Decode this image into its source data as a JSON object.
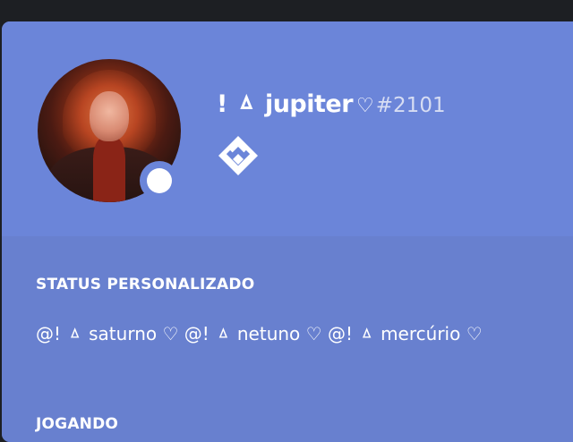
{
  "profile": {
    "username": "! ㅿ jupiter",
    "heart_icon": "♡",
    "discriminator": "#2101",
    "status": "online",
    "badge_icon": "hypesquad-diamond-icon"
  },
  "sections": {
    "custom_status_title": "STATUS PERSONALIZADO",
    "custom_status_text": "@! ㅿ saturno ♡ @! ㅿ netuno ♡ @! ㅿ mercúrio ♡",
    "playing_title": "JOGANDO"
  },
  "colors": {
    "header_bg": "#6b85d9",
    "body_bg": "#6880cf",
    "status_color": "#ffffff"
  }
}
